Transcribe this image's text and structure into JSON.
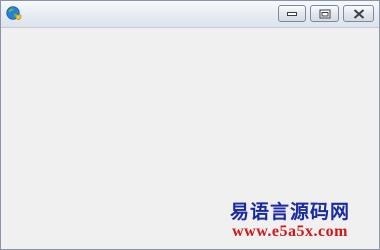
{
  "window": {
    "icon": "globe-shield-icon",
    "buttons": {
      "minimize": "minimize-icon",
      "maximize": "maximize-icon",
      "close": "close-icon"
    }
  },
  "watermark": {
    "title": "易语言源码网",
    "url": "www.e5a5x.com"
  },
  "colors": {
    "client_bg": "#f0f0f0",
    "watermark_title": "#1a2aa0",
    "watermark_url": "#d01818"
  }
}
